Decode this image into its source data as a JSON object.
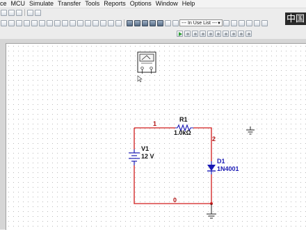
{
  "menu": {
    "items": [
      "ce",
      "MCU",
      "Simulate",
      "Transfer",
      "Tools",
      "Reports",
      "Options",
      "Window",
      "Help"
    ]
  },
  "toolbar": {
    "in_use_list": "--- In Use List ---",
    "logo_text": "中国"
  },
  "schematic": {
    "resistor": {
      "ref": "R1",
      "value": "1.0kΩ"
    },
    "source": {
      "ref": "V1",
      "value": "12 V"
    },
    "diode": {
      "ref": "D1",
      "value": "1N4001"
    },
    "nets": {
      "n1": "1",
      "n2": "2",
      "n0": "0"
    },
    "colors": {
      "wire": "#d11a1a",
      "component": "#1a1ab5",
      "text": "#111111"
    }
  }
}
